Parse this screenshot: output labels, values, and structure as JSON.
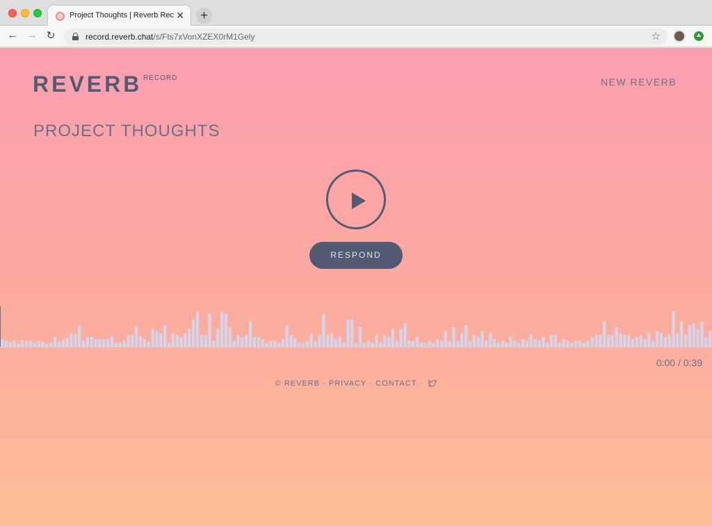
{
  "browser": {
    "tab_title": "Project Thoughts | Reverb Record",
    "new_tab_label": "+",
    "close_label": "✕",
    "url_host": "record.reverb.chat",
    "url_path": "/s/Fts7xVonXZEX0rM1Gely",
    "back_label": "←",
    "forward_label": "→",
    "reload_label": "↻",
    "bookmark_label": "☆"
  },
  "header": {
    "logo": "REVERB",
    "logo_sub": "RECORD",
    "new_reverb": "NEW REVERB"
  },
  "main": {
    "title": "PROJECT THOUGHTS",
    "respond_label": "RESPOND",
    "time": "0:00 / 0:39",
    "playback_progress": 0
  },
  "waveform": {
    "levels": [
      8,
      6,
      5,
      6,
      3,
      7,
      6,
      6,
      4,
      6,
      5,
      3,
      4,
      10,
      5,
      7,
      9,
      14,
      13,
      22,
      6,
      10,
      10,
      8,
      8,
      8,
      8,
      11,
      4,
      4,
      6,
      12,
      12,
      20,
      11,
      8,
      5,
      18,
      16,
      14,
      22,
      4,
      14,
      12,
      10,
      14,
      18,
      28,
      36,
      12,
      12,
      34,
      6,
      18,
      36,
      34,
      20,
      6,
      12,
      10,
      12,
      26,
      10,
      10,
      8,
      4,
      6,
      6,
      4,
      8,
      22,
      12,
      9,
      4,
      4,
      6,
      14,
      6,
      12,
      34,
      12,
      14,
      8,
      10,
      4,
      28,
      28,
      4,
      20,
      4,
      6,
      4,
      12,
      4,
      12,
      10,
      18,
      6,
      18,
      24,
      6,
      6,
      10,
      4,
      4,
      6,
      4,
      8,
      6,
      16,
      6,
      20,
      6,
      14,
      22,
      6,
      12,
      10,
      16,
      6,
      14,
      8,
      4,
      6,
      4,
      10,
      6,
      4,
      8,
      6,
      12,
      8,
      6,
      10,
      4,
      12,
      12,
      4,
      8,
      6,
      4,
      6,
      6,
      4,
      6,
      10,
      12,
      12,
      26,
      12,
      12,
      20,
      14,
      12,
      12,
      8,
      10,
      12,
      8,
      14,
      6,
      16,
      14,
      10,
      12,
      36,
      14,
      26,
      12,
      22,
      24,
      18,
      26,
      10,
      16
    ],
    "bar_color": "#d4d4ec"
  },
  "footer": {
    "copyright": "© REVERB",
    "sep1": "·",
    "privacy": "PRIVACY",
    "sep2": "·",
    "contact": "CONTACT",
    "sep3": "·"
  },
  "colors": {
    "accent": "#545a73",
    "gradient_top": "#fb9fb0",
    "gradient_bottom": "#fdbe96"
  }
}
